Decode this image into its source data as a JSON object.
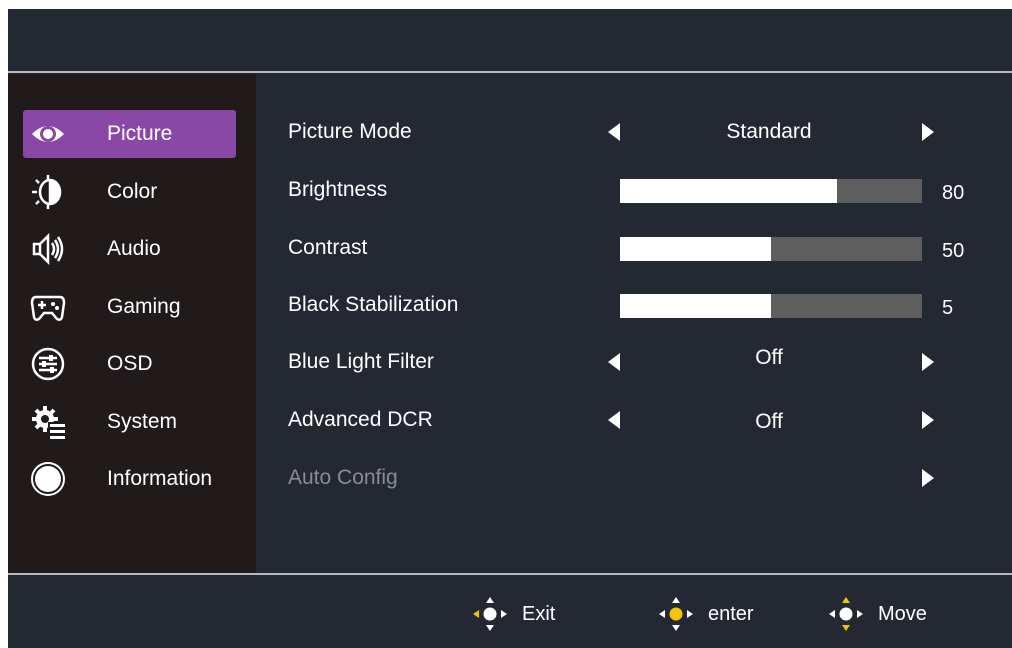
{
  "colors": {
    "background": "#242833",
    "sidebar": "#211a1a",
    "selected": "#8a48a6",
    "bar_track": "#5e5e5e",
    "bar_fill": "#ffffff",
    "joystick": "#f5c400"
  },
  "sidebar": {
    "items": [
      {
        "label": "Picture",
        "icon": "eye-icon",
        "selected": true
      },
      {
        "label": "Color",
        "icon": "color-icon"
      },
      {
        "label": "Audio",
        "icon": "speaker-icon"
      },
      {
        "label": "Gaming",
        "icon": "gamepad-icon"
      },
      {
        "label": "OSD",
        "icon": "sliders-icon"
      },
      {
        "label": "System",
        "icon": "system-gear-icon"
      },
      {
        "label": "Information",
        "icon": "info-circle-icon"
      }
    ]
  },
  "settings": {
    "picture_mode": {
      "label": "Picture Mode",
      "value": "Standard"
    },
    "brightness": {
      "label": "Brightness",
      "value": "80",
      "level": 0.72
    },
    "contrast": {
      "label": "Contrast",
      "value": "50",
      "level": 0.5
    },
    "black_stabilization": {
      "label": "Black Stabilization",
      "value": "5",
      "level": 0.5
    },
    "blue_light_filter": {
      "label": "Blue Light Filter",
      "value": "Off"
    },
    "advanced_dcr": {
      "label": "Advanced DCR",
      "value": "Off"
    },
    "auto_config": {
      "label": "Auto Config",
      "disabled": true
    }
  },
  "footer": {
    "exit_label": "Exit",
    "enter_label": "enter",
    "move_label": "Move"
  }
}
